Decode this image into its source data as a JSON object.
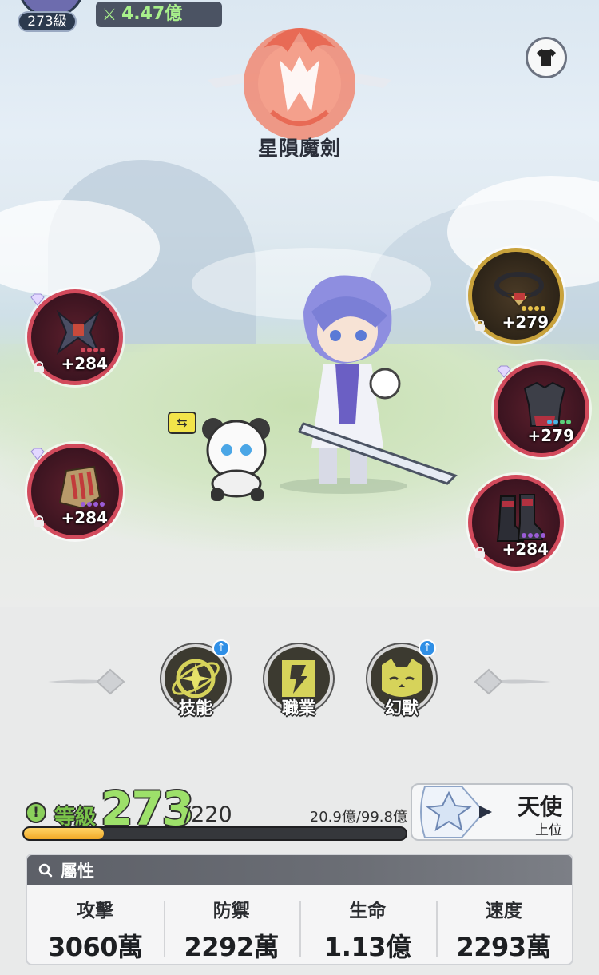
{
  "header": {
    "player_level": "273級",
    "power": "4.47億",
    "power_icon": "crossed-swords-icon"
  },
  "character": {
    "class_name": "星隕魔劍",
    "emblem": "crimson-flame-emblem"
  },
  "equipment": {
    "left": [
      {
        "name": "weapon-slot",
        "bonus": "+284",
        "gem_colors": [
          "#d24a5c",
          "#d24a5c",
          "#d24a5c",
          "#d24a5c"
        ]
      },
      {
        "name": "gauntlet-slot",
        "bonus": "+284",
        "gem_colors": [
          "#9a5cd6",
          "#9a5cd6",
          "#9a5cd6",
          "#9a5cd6"
        ]
      }
    ],
    "right": [
      {
        "name": "necklace-slot",
        "bonus": "+279",
        "gem_colors": [
          "#e6c14a",
          "#e6c14a",
          "#e6c14a",
          "#e6c14a"
        ]
      },
      {
        "name": "armor-slot",
        "bonus": "+279",
        "gem_colors": [
          "#4ab6e6",
          "#4ab6e6",
          "#5bd07a",
          "#5bd07a"
        ]
      },
      {
        "name": "boots-slot",
        "bonus": "+284",
        "gem_colors": [
          "#9a5cd6",
          "#9a5cd6",
          "#9a5cd6",
          "#9a5cd6"
        ]
      }
    ]
  },
  "actions": [
    {
      "label": "技能",
      "has_upgrade": true
    },
    {
      "label": "職業",
      "has_upgrade": false
    },
    {
      "label": "幻獸",
      "has_upgrade": true
    }
  ],
  "level": {
    "icon": "!",
    "label": "等級",
    "value": "273",
    "cap": "/220",
    "exp_text": "20.9億/99.8億",
    "exp_progress": 0.21
  },
  "rank": {
    "title": "天使",
    "subtitle": "上位"
  },
  "attributes": {
    "title": "屬性",
    "items": [
      {
        "name": "攻擊",
        "value": "3060萬"
      },
      {
        "name": "防禦",
        "value": "2292萬"
      },
      {
        "name": "生命",
        "value": "1.13億"
      },
      {
        "name": "速度",
        "value": "2293萬"
      }
    ]
  },
  "colors": {
    "slot_border": "#d24a5c",
    "slot_gold": "#c9a23b",
    "level_green": "#9de06a",
    "exp_fill": "#f0a826",
    "upgrade_blue": "#2f8fe6"
  }
}
